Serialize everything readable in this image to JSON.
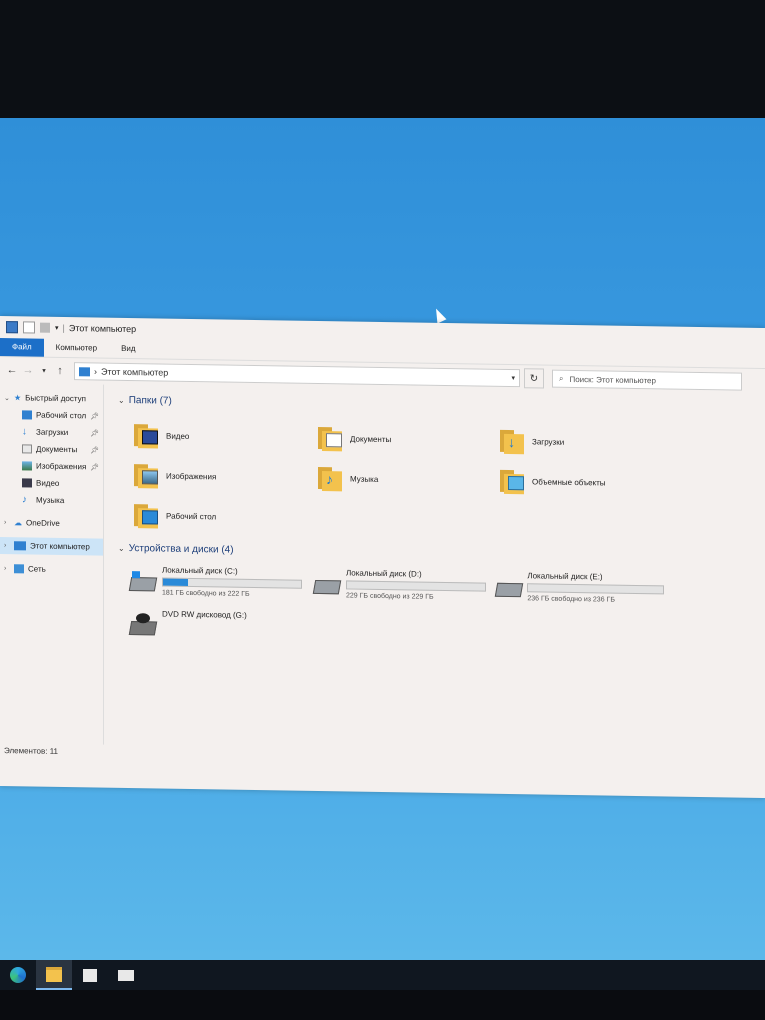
{
  "window": {
    "title": "Этот компьютер",
    "tabs": [
      {
        "label": "Файл"
      },
      {
        "label": "Компьютер"
      },
      {
        "label": "Вид"
      }
    ]
  },
  "address": {
    "path": "Этот компьютер"
  },
  "search": {
    "placeholder": "Поиск: Этот компьютер"
  },
  "sidebar": {
    "quick_access": "Быстрый доступ",
    "quick_items": [
      {
        "label": "Рабочий стол",
        "icon": "desktop-icon",
        "pinned": true
      },
      {
        "label": "Загрузки",
        "icon": "download-icon",
        "pinned": true
      },
      {
        "label": "Документы",
        "icon": "documents-icon",
        "pinned": true
      },
      {
        "label": "Изображения",
        "icon": "pictures-icon",
        "pinned": true
      },
      {
        "label": "Видео",
        "icon": "video-icon",
        "pinned": false
      },
      {
        "label": "Музыка",
        "icon": "music-icon",
        "pinned": false
      }
    ],
    "onedrive": "OneDrive",
    "this_pc": "Этот компьютер",
    "network": "Сеть"
  },
  "folders": {
    "header": "Папки (7)",
    "items": [
      {
        "name": "Видео",
        "icon": "video-folder-icon"
      },
      {
        "name": "Документы",
        "icon": "documents-folder-icon"
      },
      {
        "name": "Загрузки",
        "icon": "downloads-folder-icon"
      },
      {
        "name": "Изображения",
        "icon": "pictures-folder-icon"
      },
      {
        "name": "Музыка",
        "icon": "music-folder-icon"
      },
      {
        "name": "Объемные объекты",
        "icon": "3d-objects-folder-icon"
      },
      {
        "name": "Рабочий стол",
        "icon": "desktop-folder-icon"
      }
    ]
  },
  "drives": {
    "header": "Устройства и диски (4)",
    "items": [
      {
        "name": "Локальный диск (C:)",
        "free": "181 ГБ свободно из 222 ГБ",
        "used_fraction": 0.18
      },
      {
        "name": "Локальный диск (D:)",
        "free": "229 ГБ свободно из 229 ГБ",
        "used_fraction": 0.0
      },
      {
        "name": "Локальный диск (E:)",
        "free": "236 ГБ свободно из 236 ГБ",
        "used_fraction": 0.0
      },
      {
        "name": "DVD RW дисковод (G:)",
        "free": "",
        "used_fraction": null
      }
    ]
  },
  "status": {
    "items": "Элементов: 11"
  },
  "taskbar": {
    "items": [
      {
        "icon": "edge-icon"
      },
      {
        "icon": "file-explorer-icon",
        "active": true
      },
      {
        "icon": "store-icon"
      },
      {
        "icon": "mail-icon"
      }
    ]
  }
}
